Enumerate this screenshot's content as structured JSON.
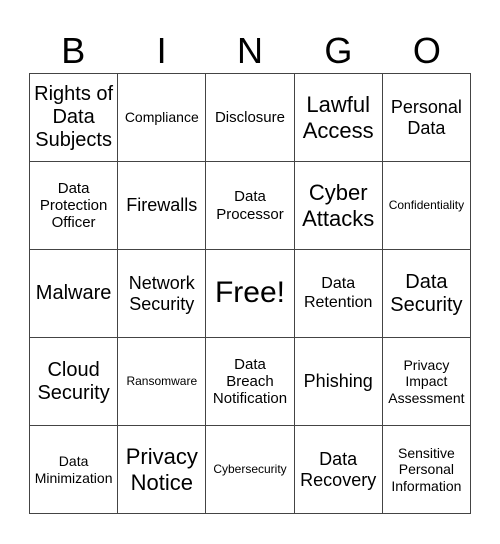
{
  "header": [
    "B",
    "I",
    "N",
    "G",
    "O"
  ],
  "cells": [
    "Rights of Data Subjects",
    "Compliance",
    "Disclosure",
    "Lawful Access",
    "Personal Data",
    "Data Protection Officer",
    "Firewalls",
    "Data Processor",
    "Cyber Attacks",
    "Confidentiality",
    "Malware",
    "Network Security",
    "Free!",
    "Data Retention",
    "Data Security",
    "Cloud Security",
    "Ransomware",
    "Data Breach Notification",
    "Phishing",
    "Privacy Impact Assessment",
    "Data Minimization",
    "Privacy Notice",
    "Cybersecurity",
    "Data Recovery",
    "Sensitive Personal Information"
  ]
}
